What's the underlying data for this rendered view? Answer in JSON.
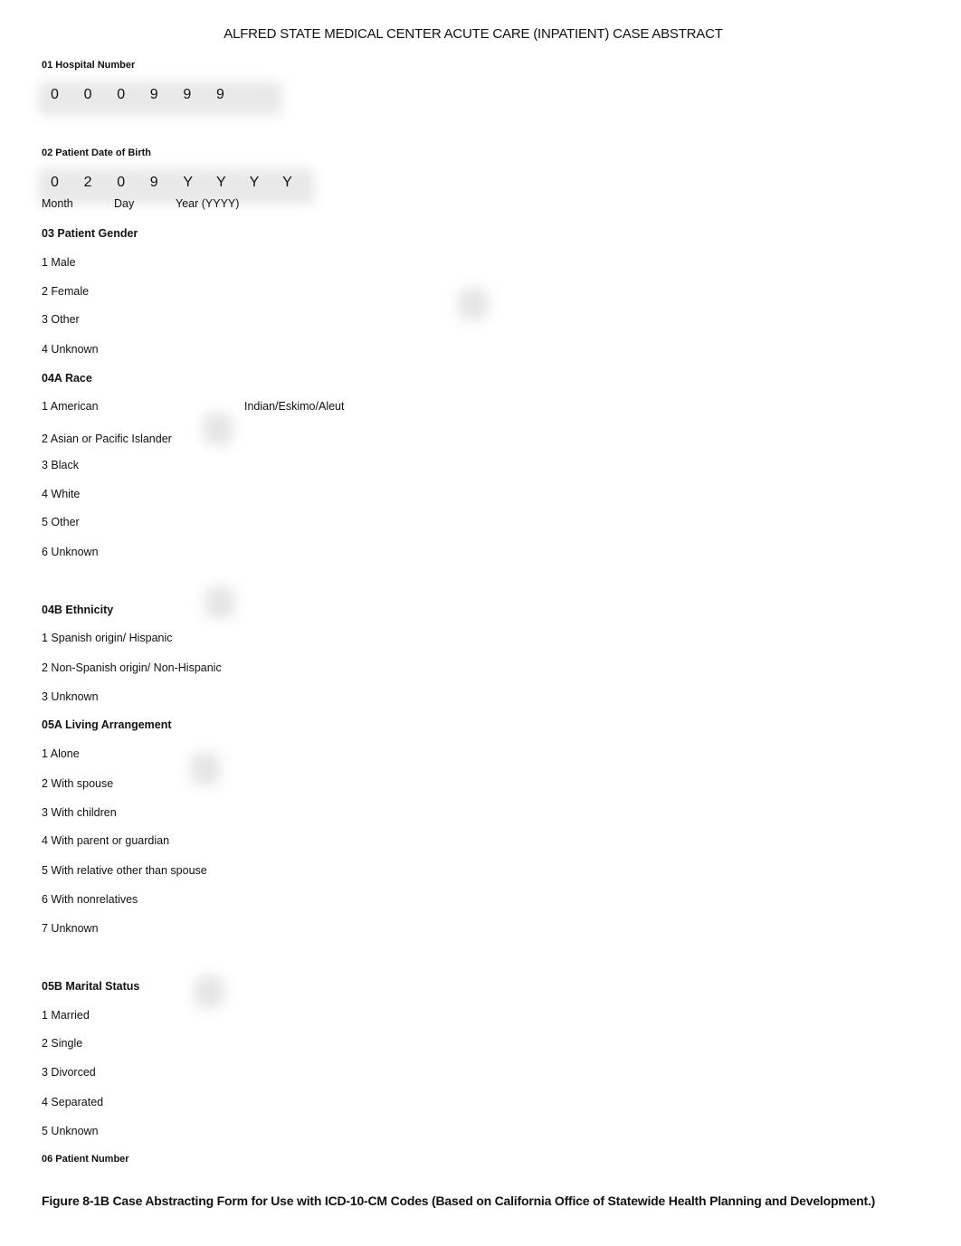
{
  "title": "ALFRED STATE MEDICAL CENTER ACUTE CARE (INPATIENT) CASE ABSTRACT",
  "hospital_number": {
    "label": "01 Hospital Number",
    "digits": [
      "0",
      "0",
      "0",
      "9",
      "9",
      "9"
    ]
  },
  "date_of_birth": {
    "label": "02 Patient Date of Birth",
    "digits": [
      "0",
      "2",
      "0",
      "9",
      "Y",
      "Y",
      "Y",
      "Y"
    ],
    "sublabels": {
      "month": "Month",
      "day": "Day",
      "year": "Year (YYYY)"
    }
  },
  "gender": {
    "label": "03 Patient Gender",
    "options": [
      "1 Male",
      "2 Female",
      "3 Other",
      "4 Unknown"
    ]
  },
  "race": {
    "label": "04A Race",
    "options": [
      "1 American",
      "2 Asian or Pacific Islander",
      "3 Black",
      "4 White",
      "5 Other",
      "6 Unknown"
    ],
    "option1_continuation": "Indian/Eskimo/Aleut"
  },
  "ethnicity": {
    "label": "04B Ethnicity",
    "options": [
      "1 Spanish origin/ Hispanic",
      "2 Non-Spanish origin/ Non-Hispanic",
      "3 Unknown"
    ]
  },
  "living_arrangement": {
    "label": "05A Living Arrangement",
    "options": [
      "1 Alone",
      "2 With spouse",
      "3 With children",
      "4 With parent or guardian",
      "5 With relative other than spouse",
      "6 With nonrelatives",
      "7 Unknown"
    ]
  },
  "marital_status": {
    "label": "05B Marital Status",
    "options": [
      "1 Married",
      "2 Single",
      "3 Divorced",
      "4 Separated",
      "5 Unknown"
    ]
  },
  "patient_number": {
    "label": "06 Patient Number"
  },
  "caption": "Figure 8-1B  Case Abstracting Form for Use with ICD-10-CM Codes (Based on California Office of Statewide Health Planning and Development.)"
}
